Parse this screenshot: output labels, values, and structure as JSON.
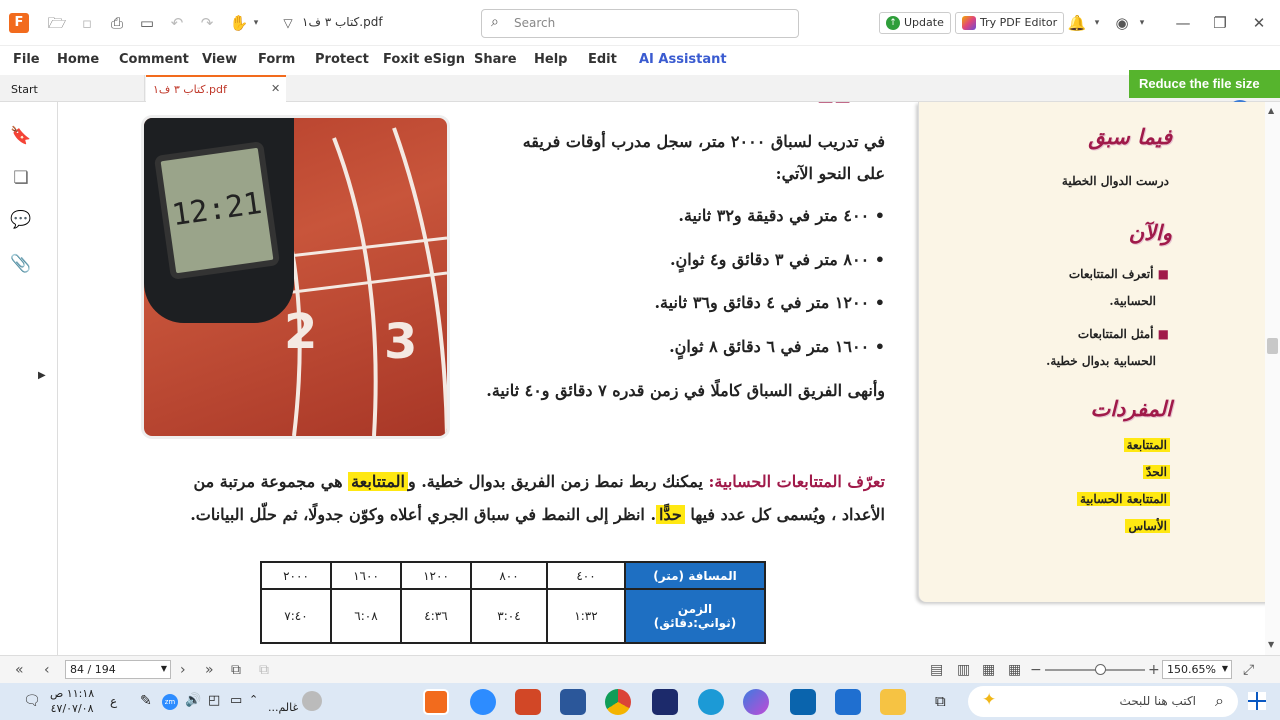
{
  "app": {
    "tab_title": "كتاب ٣ ف١.pdf",
    "search_placeholder": "Search",
    "update": "Update",
    "try_editor": "Try PDF Editor"
  },
  "menu": [
    "File",
    "Home",
    "Comment",
    "View",
    "Form",
    "Protect",
    "Foxit eSign",
    "Share",
    "Help",
    "Edit",
    "AI Assistant"
  ],
  "tabs": {
    "start": "Start",
    "doc": "كتاب ٣ ف١.pdf"
  },
  "reduce": "Reduce the file size",
  "page": {
    "intro1": "في تدريب لسباق ٢٠٠٠ متر، سجل مدرب أوقات فريقه",
    "intro2": "على النحو الآتي:",
    "bullets": [
      "٤٠٠ متر في دقيقة و٣٢ ثانية.",
      "٨٠٠ متر في ٣ دقائق و٤ ثوانٍ.",
      "١٢٠٠ متر في ٤ دقائق و٣٦ ثانية.",
      "١٦٠٠ متر في ٦ دقائق ٨ ثوانٍ."
    ],
    "finish": "وأنهى الفريق السباق كاملًا في زمن قدره ٧ دقائق و٤٠ ثانية.",
    "para_title": "تعرّف المتتابعات الحسابية:",
    "para1_rest": "يمكنك ربط نمط زمن الفريق بدوال خطية. و",
    "para1_hl": "المتتابعة",
    "para1_end": "هي مجموعة مرتبة من",
    "para2_start": "الأعداد ، ويُسمى كل عدد فيها",
    "para2_hl": "حدًّا",
    "para2_end": ". انظر إلى النمط في سباق الجري أعلاه وكوّن جدولًا، ثم حلّل البيانات.",
    "table": {
      "h1": "المسافة (متر)",
      "h2a": "الزمن",
      "h2b": "(ثواني:دقائق)",
      "distances": [
        "٤٠٠",
        "٨٠٠",
        "١٢٠٠",
        "١٦٠٠",
        "٢٠٠٠"
      ],
      "times": [
        "١:٣٢",
        "٣:٠٤",
        "٤:٣٦",
        "٦:٠٨",
        "٧:٤٠"
      ]
    },
    "stopwatch": "12:21"
  },
  "panel": {
    "h1": "فيما سبق",
    "t1": "درست الدوال الخطية",
    "h2": "والآن",
    "o1a": "أتعرف المتتابعات",
    "o1b": "الحسابية.",
    "o2a": "أمثل المتتابعات",
    "o2b": "الحسابية بدوال خطية.",
    "h3": "المفردات",
    "v": [
      "المتتابعة",
      "الحدّ",
      "المتتابعة الحسابية",
      "الأساس"
    ]
  },
  "status": {
    "page": "84 / 194",
    "zoom": "150.65%"
  },
  "taskbar": {
    "search": "اكتب هنا للبحث",
    "time": "١١:١٨ ص",
    "date": "٤٧/٠٧/٠٨",
    "user": "غالم...",
    "lang": "ع"
  }
}
